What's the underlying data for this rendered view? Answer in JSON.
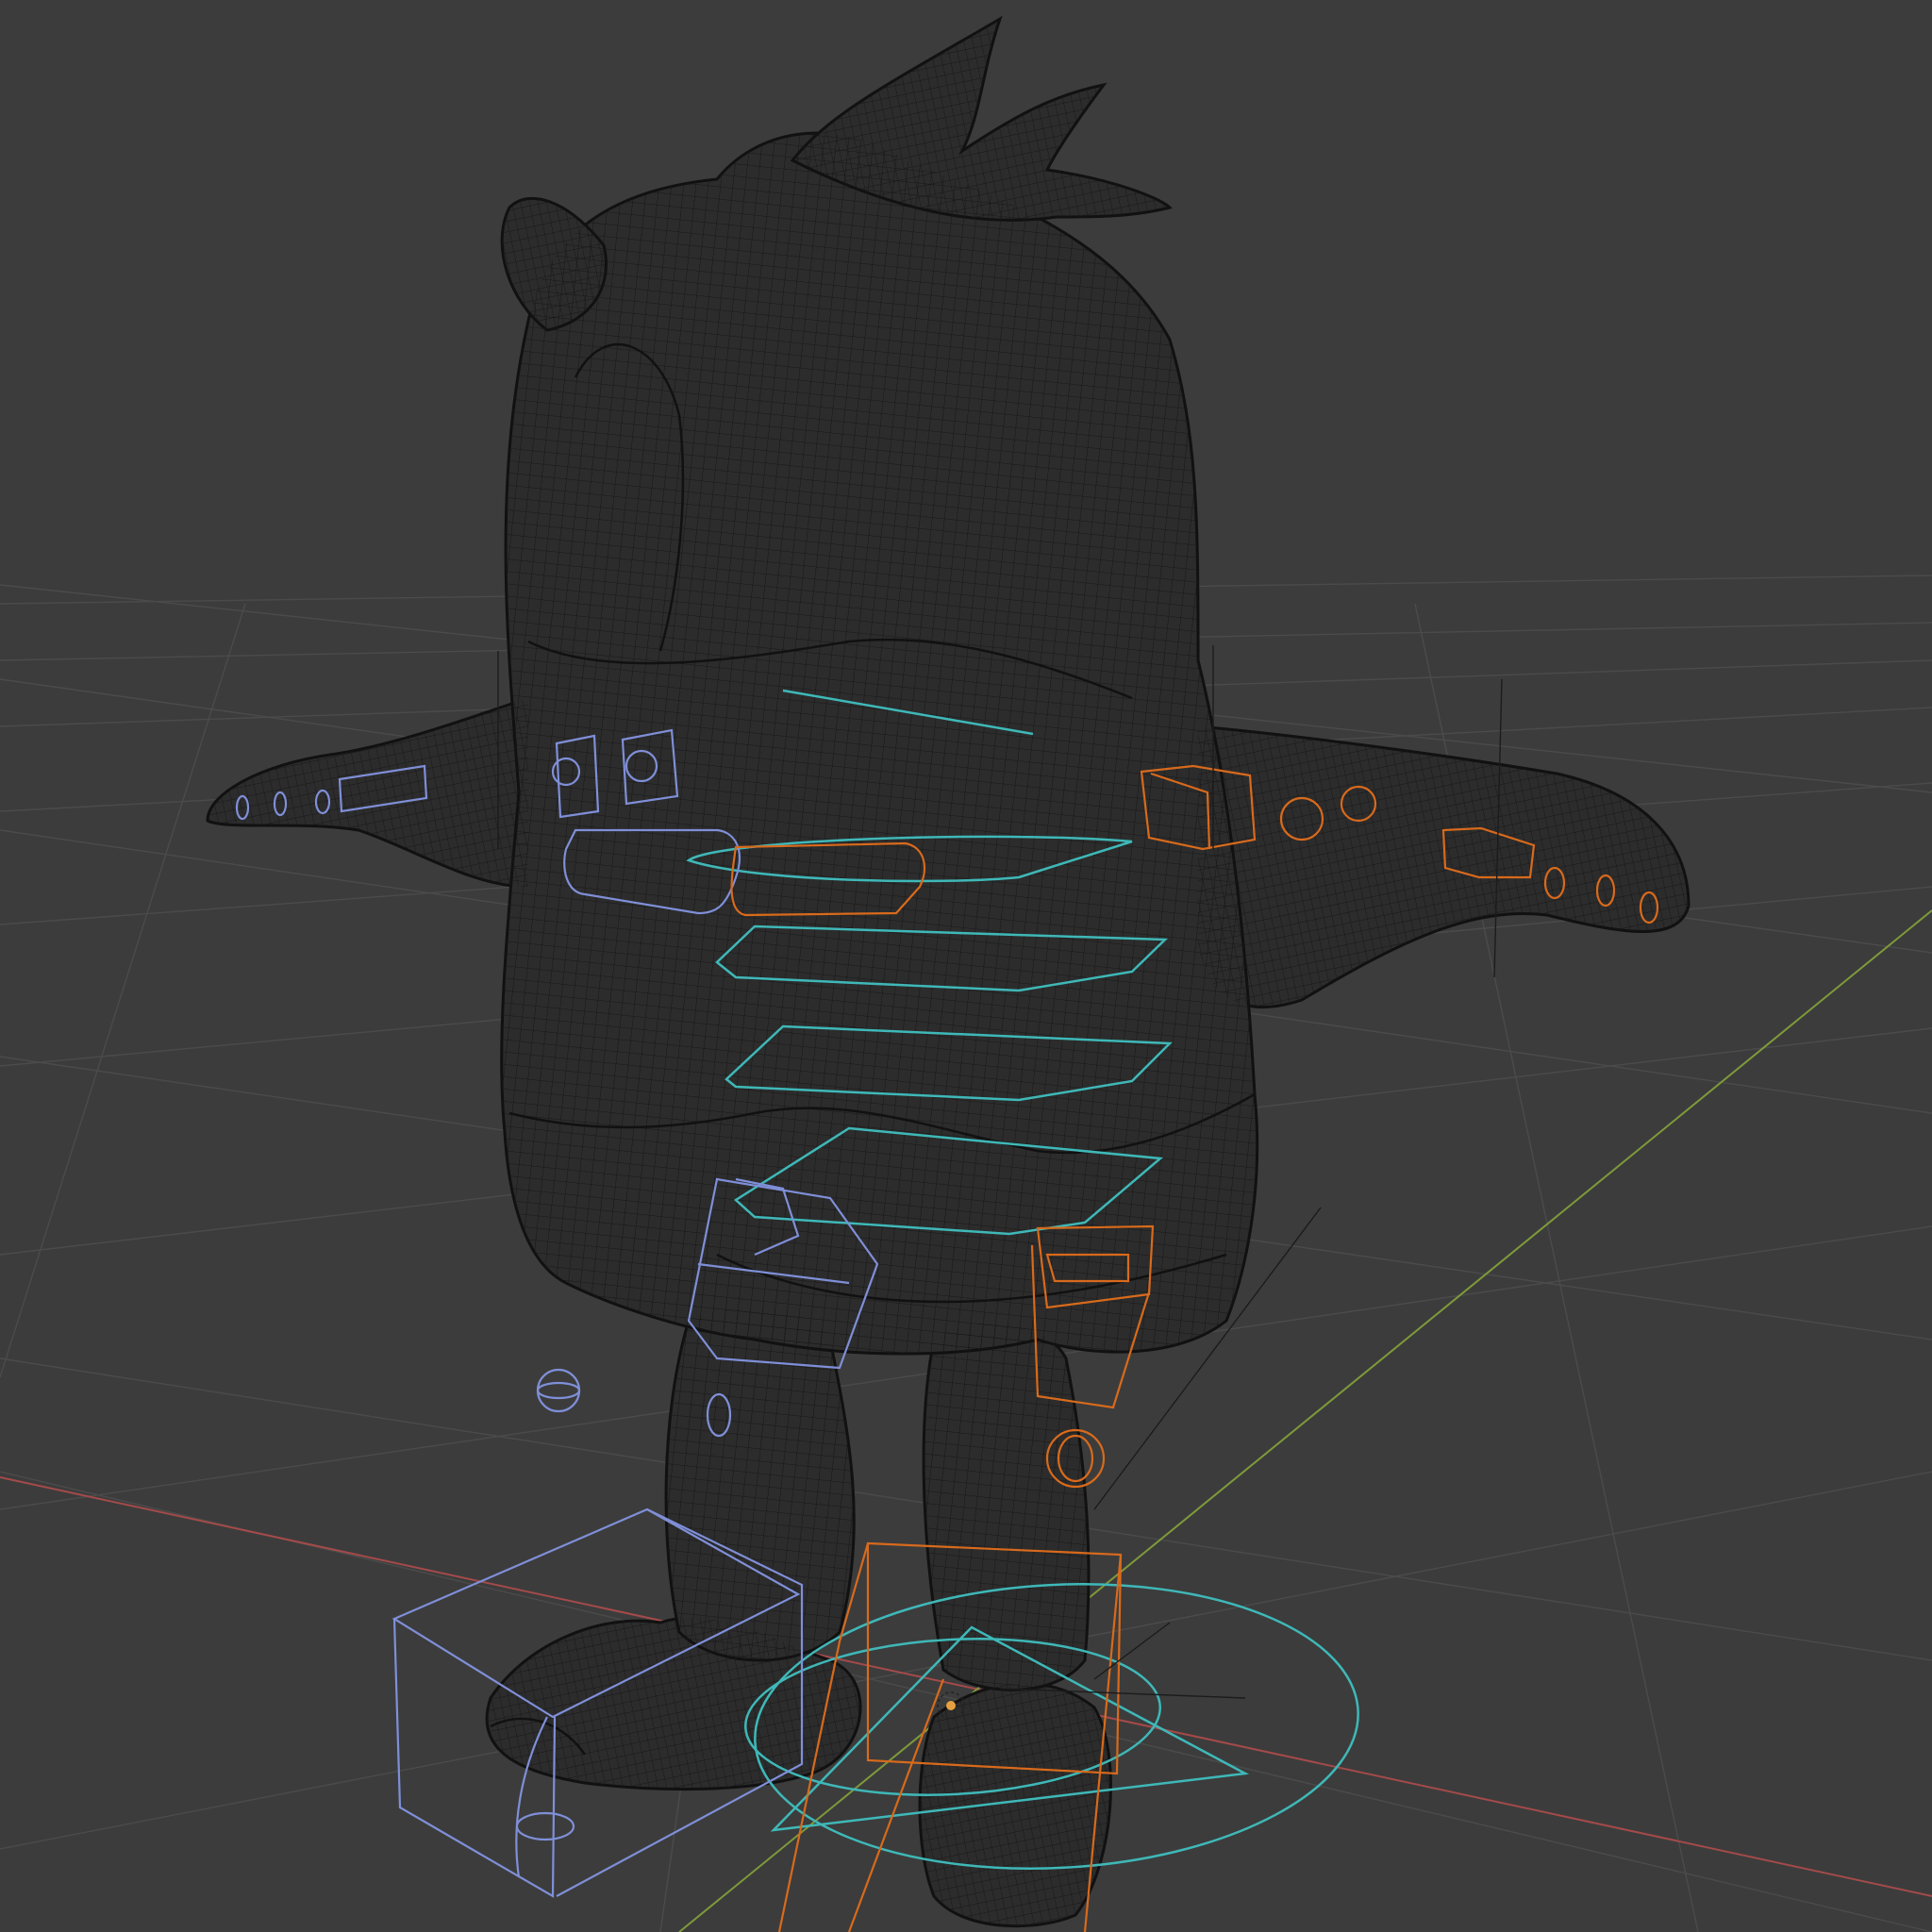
{
  "viewport": {
    "mode": "wireframe",
    "background_color": "#3c3c3c",
    "colors": {
      "grid": "#4a4a4a",
      "x_axis": "#a04848",
      "y_axis": "#7e9a3a",
      "mesh_wire": "#141414",
      "left_controls": "#7f8fd8",
      "right_controls": "#d86a1c",
      "center_controls": "#3fb8b8"
    },
    "objects": [
      {
        "name": "owl-character-mesh",
        "shading": "wireframe"
      },
      {
        "name": "armature-rig-controls",
        "left_side": "blue",
        "right_side": "orange",
        "center": "cyan"
      }
    ]
  }
}
